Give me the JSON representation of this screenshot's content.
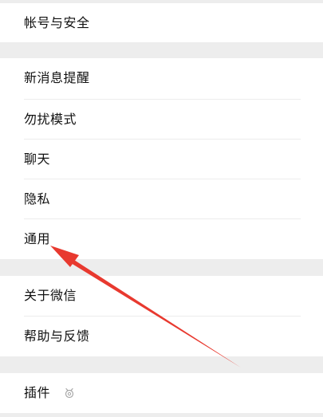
{
  "settings": {
    "account_security": "帐号与安全",
    "new_message_notification": "新消息提醒",
    "do_not_disturb": "勿扰模式",
    "chat": "聊天",
    "privacy": "隐私",
    "general": "通用",
    "about_wechat": "关于微信",
    "help_feedback": "帮助与反馈",
    "plugins": "插件"
  },
  "plugins_icon": "plugin-icon",
  "annotation": {
    "color": "#e8392f",
    "points_to": "通用"
  }
}
